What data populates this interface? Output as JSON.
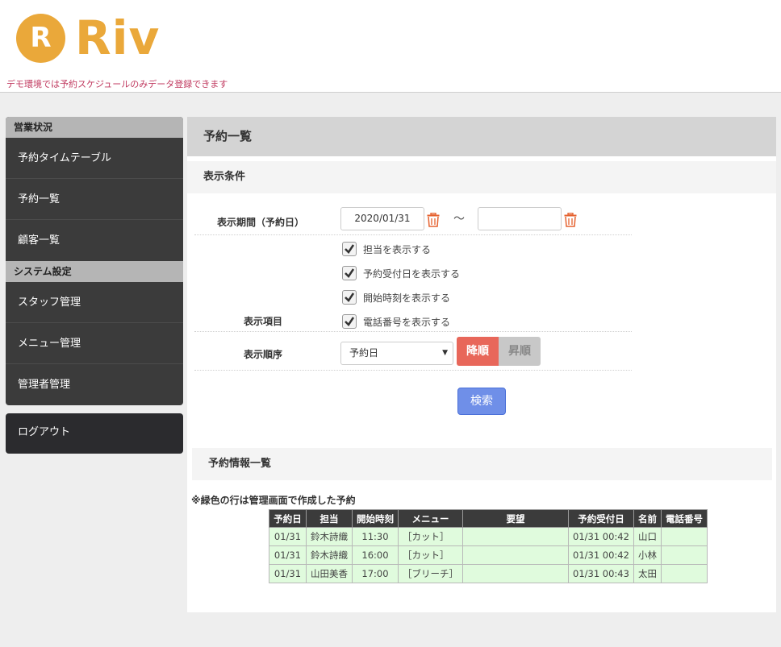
{
  "brand": {
    "logo_letter": "R",
    "logo_text": "Riv",
    "color": "#eaa83a"
  },
  "demo_note": "デモ環境では予約スケジュールのみデータ登録できます",
  "sidebar": {
    "group1_title": "営業状況",
    "group1_items": [
      "予約タイムテーブル",
      "予約一覧",
      "顧客一覧"
    ],
    "group2_title": "システム設定",
    "group2_items": [
      "スタッフ管理",
      "メニュー管理",
      "管理者管理"
    ],
    "logout": "ログアウト"
  },
  "main": {
    "title": "予約一覧",
    "conditions": {
      "title": "表示条件",
      "period_label": "表示期間（予約日）",
      "date_from": "2020/01/31",
      "date_to": "",
      "tilde": "～",
      "items_label": "表示項目",
      "checkboxes": [
        {
          "label": "担当を表示する",
          "checked": true
        },
        {
          "label": "予約受付日を表示する",
          "checked": true
        },
        {
          "label": "開始時刻を表示する",
          "checked": true
        },
        {
          "label": "電話番号を表示する",
          "checked": true
        }
      ],
      "order_label": "表示順序",
      "order_selected": "予約日",
      "sort_desc": "降順",
      "sort_asc": "昇順",
      "search_button": "検索"
    },
    "list": {
      "title": "予約情報一覧",
      "note": "※緑色の行は管理画面で作成した予約",
      "columns": [
        "予約日",
        "担当",
        "開始時刻",
        "メニュー",
        "要望",
        "予約受付日",
        "名前",
        "電話番号"
      ],
      "rows": [
        [
          "01/31",
          "鈴木詩織",
          "11:30",
          "［カット］",
          "",
          "01/31 00:42",
          "山口",
          ""
        ],
        [
          "01/31",
          "鈴木詩織",
          "16:00",
          "［カット］",
          "",
          "01/31 00:42",
          "小林",
          ""
        ],
        [
          "01/31",
          "山田美香",
          "17:00",
          "［ブリーチ］",
          "",
          "01/31 00:43",
          "太田",
          ""
        ]
      ]
    }
  },
  "colors": {
    "accent_red": "#e8675a",
    "search_blue": "#6f8fe8",
    "row_green": "#e0fbdd",
    "note_pink": "#c0395f"
  }
}
